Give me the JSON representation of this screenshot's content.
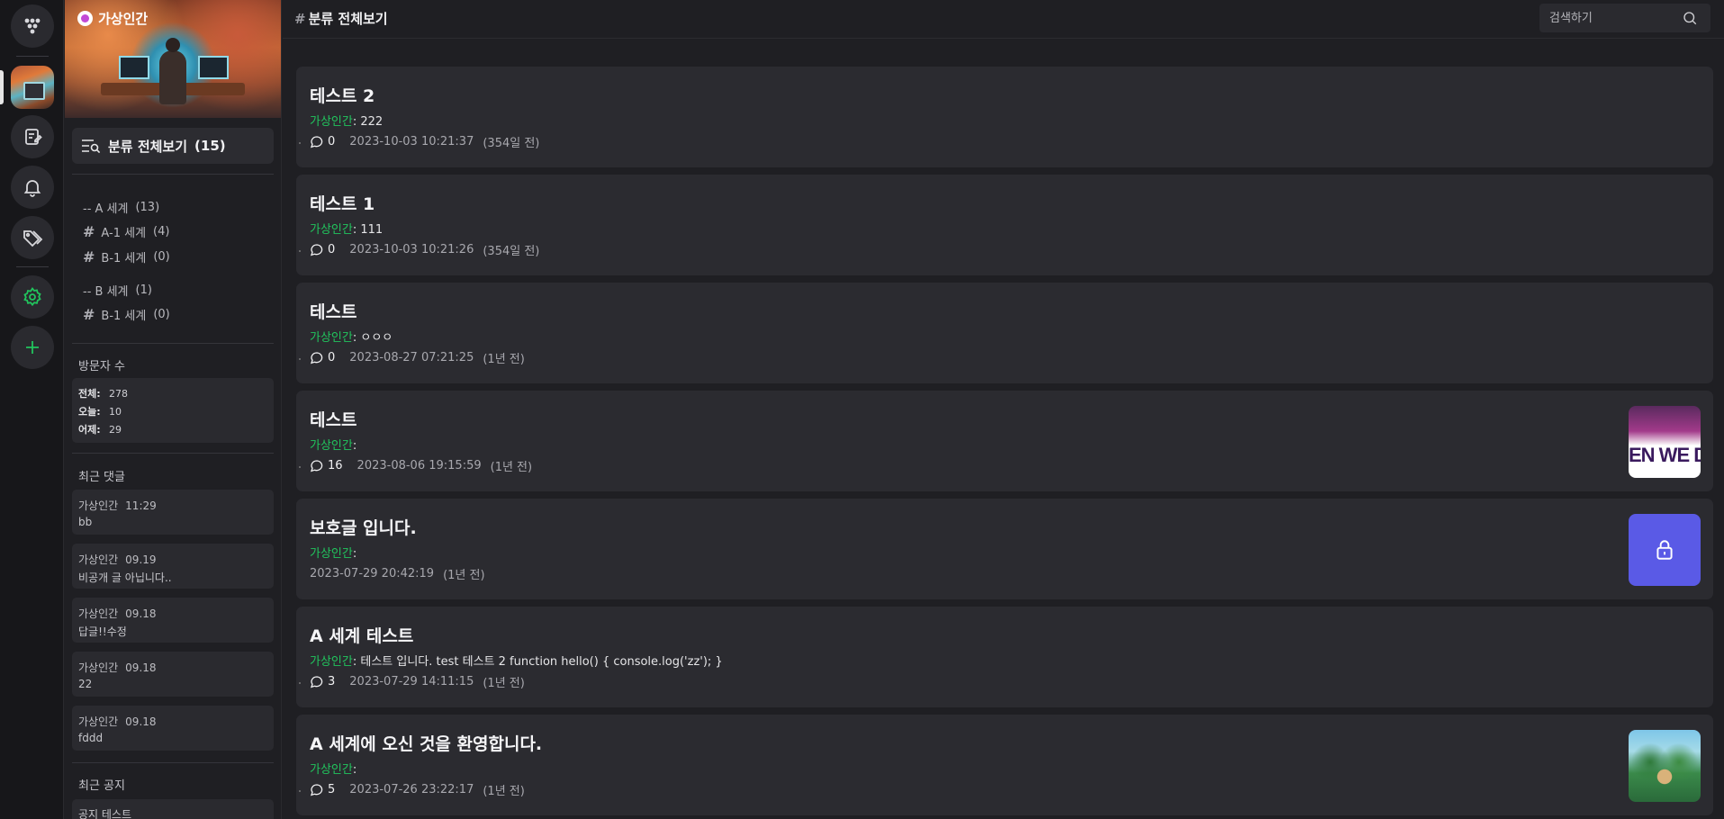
{
  "blog": {
    "name": "가상인간"
  },
  "rail": {
    "icons": [
      "apps-icon",
      "blog-thumbnail",
      "write-icon",
      "bell-icon",
      "tags-icon",
      "settings-icon",
      "plus-icon"
    ]
  },
  "sidebar": {
    "all_categories": {
      "label": "분류 전체보기",
      "count": "(15)"
    },
    "categories": [
      {
        "name": "-- A 세계",
        "count": "(13)",
        "hash": false
      },
      {
        "name": "A-1 세계",
        "count": "(4)",
        "hash": true
      },
      {
        "name": "B-1 세계",
        "count": "(0)",
        "hash": true
      },
      {
        "name": "-- B 세계",
        "count": "(1)",
        "hash": false
      },
      {
        "name": "B-1 세계",
        "count": "(0)",
        "hash": true
      }
    ],
    "visitors": {
      "title": "방문자 수",
      "total_label": "전체:",
      "total": "278",
      "today_label": "오늘:",
      "today": "10",
      "yesterday_label": "어제:",
      "yesterday": "29"
    },
    "recent_comments": {
      "title": "최근 댓글",
      "items": [
        {
          "author": "가상인간",
          "time": "11:29",
          "text": "bb"
        },
        {
          "author": "가상인간",
          "time": "09.19",
          "text": "비공개 글 아닙니다.."
        },
        {
          "author": "가상인간",
          "time": "09.18",
          "text": "답글!!수정"
        },
        {
          "author": "가상인간",
          "time": "09.18",
          "text": "22"
        },
        {
          "author": "가상인간",
          "time": "09.18",
          "text": "fddd"
        }
      ]
    },
    "recent_notices": {
      "title": "최근 공지",
      "items": [
        {
          "text": "공지 테스트"
        }
      ]
    }
  },
  "header": {
    "hash": "#",
    "title": "분류 전체보기",
    "search_placeholder": "검색하기"
  },
  "posts": [
    {
      "title": "테스트 2",
      "author": "가상인간",
      "excerpt": ": 222",
      "comments": "0",
      "date": "2023-10-03 10:21:37",
      "ago": "(354일 전)",
      "thumb": "none"
    },
    {
      "title": "테스트 1",
      "author": "가상인간",
      "excerpt": ": 111",
      "comments": "0",
      "date": "2023-10-03 10:21:26",
      "ago": "(354일 전)",
      "thumb": "none"
    },
    {
      "title": "테스트",
      "author": "가상인간",
      "excerpt": ": ㅇㅇㅇ",
      "comments": "0",
      "date": "2023-08-27 07:21:25",
      "ago": "(1년 전)",
      "thumb": "none"
    },
    {
      "title": "테스트",
      "author": "가상인간",
      "excerpt": ":",
      "comments": "16",
      "date": "2023-08-06 19:15:59",
      "ago": "(1년 전)",
      "thumb": "music",
      "thumb_text": "EN WE DIS"
    },
    {
      "title": "보호글 입니다.",
      "author": "가상인간",
      "excerpt": ":",
      "comments": "",
      "date": "2023-07-29 20:42:19",
      "ago": "(1년 전)",
      "thumb": "lock"
    },
    {
      "title": "A 세계 테스트",
      "author": "가상인간",
      "excerpt": ": 테스트 입니다. test 테스트 2 function hello() { console.log('zz'); }",
      "comments": "3",
      "date": "2023-07-29 14:11:15",
      "ago": "(1년 전)",
      "thumb": "none"
    },
    {
      "title": "A 세계에 오신 것을 환영합니다.",
      "author": "가상인간",
      "excerpt": ":",
      "comments": "5",
      "date": "2023-07-26 23:22:17",
      "ago": "(1년 전)",
      "thumb": "forest"
    }
  ],
  "colors": {
    "accent_green": "#21c45d",
    "lock_purple": "#5a5ae6",
    "background": "#1f1f23",
    "card": "#2b2b30"
  }
}
